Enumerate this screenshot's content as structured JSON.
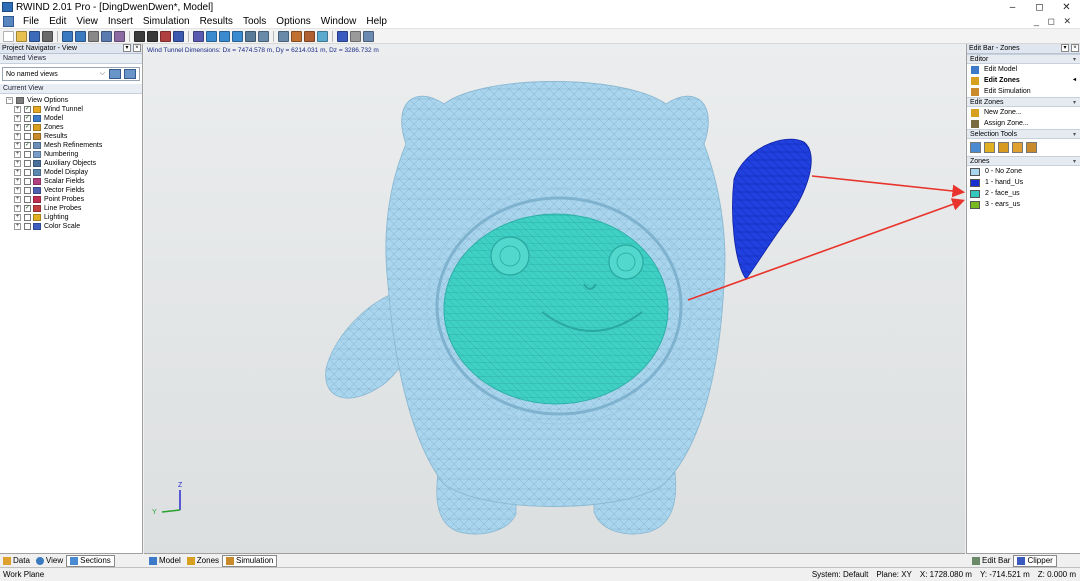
{
  "window": {
    "title": "RWIND 2.01 Pro - [DingDwenDwen*, Model]",
    "controls": [
      "–",
      "◻",
      "✕"
    ]
  },
  "menu": {
    "items": [
      "File",
      "Edit",
      "View",
      "Insert",
      "Simulation",
      "Results",
      "Tools",
      "Options",
      "Window",
      "Help"
    ],
    "doc_controls": "_ ◻ ✕"
  },
  "toolbar": {
    "icons": [
      "new-icon",
      "open-icon",
      "save-icon",
      "print-icon",
      "undo-icon",
      "redo-icon",
      "cut-icon",
      "copy-icon",
      "paste-icon",
      "select-icon",
      "zone-icon",
      "mesh-icon",
      "probe-icon",
      "view-iso-icon",
      "view-top-icon",
      "view-front-icon",
      "view-side-icon",
      "zoom-all-icon",
      "rotate-icon",
      "pan-icon",
      "render-icon",
      "color-icon",
      "section-icon",
      "clipper-icon",
      "grid-icon",
      "settings-icon"
    ]
  },
  "navigator": {
    "title": "Project Navigator - View",
    "named_views_label": "Named Views",
    "named_views_value": "No named views",
    "current_view_label": "Current View",
    "tree": [
      {
        "label": "View Options",
        "level": 0,
        "check": false,
        "icon": "#7d7d7d"
      },
      {
        "label": "Wind Tunnel",
        "level": 1,
        "check": true,
        "icon": "#e6a822"
      },
      {
        "label": "Model",
        "level": 1,
        "check": true,
        "icon": "#3d7bc8"
      },
      {
        "label": "Zones",
        "level": 1,
        "check": true,
        "icon": "#d8a020"
      },
      {
        "label": "Results",
        "level": 1,
        "check": false,
        "icon": "#c88a2a"
      },
      {
        "label": "Mesh Refinements",
        "level": 1,
        "check": true,
        "icon": "#6b8fb8"
      },
      {
        "label": "Numbering",
        "level": 1,
        "check": false,
        "icon": "#7a9cc8"
      },
      {
        "label": "Auxiliary Objects",
        "level": 1,
        "check": false,
        "icon": "#4a6f9c"
      },
      {
        "label": "Model Display",
        "level": 1,
        "check": false,
        "icon": "#5d88b0"
      },
      {
        "label": "Scalar Fields",
        "level": 1,
        "check": false,
        "icon": "#b04080"
      },
      {
        "label": "Vector Fields",
        "level": 1,
        "check": false,
        "icon": "#5060b0"
      },
      {
        "label": "Point Probes",
        "level": 1,
        "check": false,
        "icon": "#c03050"
      },
      {
        "label": "Line Probes",
        "level": 1,
        "check": true,
        "icon": "#c04040"
      },
      {
        "label": "Lighting",
        "level": 1,
        "check": false,
        "icon": "#e0b020"
      },
      {
        "label": "Color Scale",
        "level": 1,
        "check": false,
        "icon": "#4060c0"
      }
    ],
    "tabs": [
      "Data",
      "View",
      "Sections"
    ]
  },
  "viewport": {
    "dimensions_text": "Wind Tunnel Dimensions: Dx = 7474.578 m, Dy = 6214.031 m, Dz = 3286.732 m",
    "axis_z": "Z",
    "axis_y": "Y",
    "tabs": [
      "Model",
      "Zones",
      "Simulation"
    ],
    "model_colors": {
      "body": "#a9d6ee",
      "face": "#3fcfc4",
      "hand": "#2040e0",
      "mesh": "#7fa8c4"
    }
  },
  "editbar": {
    "title": "Edit Bar - Zones",
    "editor_label": "Editor",
    "editor_items": [
      "Edit Model",
      "Edit Zones",
      "Edit Simulation"
    ],
    "edit_zones_label": "Edit Zones",
    "zone_actions": [
      "New Zone...",
      "Assign Zone..."
    ],
    "selection_tools_label": "Selection Tools",
    "zones_label": "Zones",
    "zones": [
      {
        "label": "0 - No Zone",
        "color": "#a9d6ee"
      },
      {
        "label": "1 - hand_Us",
        "color": "#1a2fd0"
      },
      {
        "label": "2 - face_us",
        "color": "#34c7c0"
      },
      {
        "label": "3 - ears_us",
        "color": "#78b820"
      }
    ],
    "bottom_tabs": [
      "Edit Bar",
      "Clipper"
    ]
  },
  "status": {
    "left": "Work Plane",
    "system": "System: Default",
    "plane": "Plane: XY",
    "x": "X: 1728.080 m",
    "y": "Y: -714.521 m",
    "z": "Z: 0.000 m"
  }
}
